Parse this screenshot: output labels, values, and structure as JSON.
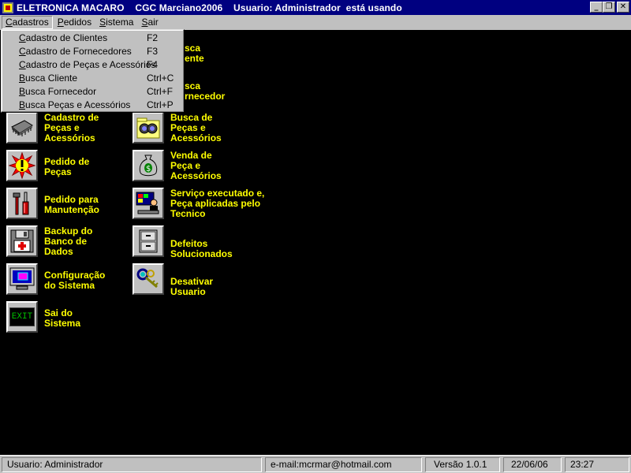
{
  "window": {
    "title": "ELETRONICA MACARO    CGC Marciano2006    Usuario: Administrador  está usando",
    "minimize_glyph": "_",
    "maximize_glyph": "❐",
    "close_glyph": "✕"
  },
  "menubar": {
    "items": [
      {
        "label": "Cadastros"
      },
      {
        "label": "Pedidos"
      },
      {
        "label": "Sistema"
      },
      {
        "label": "Sair"
      }
    ]
  },
  "dropdown": {
    "items": [
      {
        "label": "Cadastro de Clientes",
        "shortcut": "F2"
      },
      {
        "label": "Cadastro de Fornecedores",
        "shortcut": "F3"
      },
      {
        "label": "Cadastro de Peças e Acessórios",
        "shortcut": "F4"
      },
      {
        "label": "Busca Cliente",
        "shortcut": "Ctrl+C"
      },
      {
        "label": "Busca Fornecedor",
        "shortcut": "Ctrl+F"
      },
      {
        "label": "Busca Peças e Acessórios",
        "shortcut": "Ctrl+P"
      }
    ]
  },
  "left_tiles": [
    {
      "label": "Cadastro de\nPeças e\nAcessórios",
      "icon": "chip-icon"
    },
    {
      "label": "Pedido de\nPeças",
      "icon": "alert-icon"
    },
    {
      "label": "Pedido para\nManutenção",
      "icon": "tools-icon"
    },
    {
      "label": "Backup do\nBanco de\nDados",
      "icon": "floppy-icon"
    },
    {
      "label": "Configuração\ndo Sistema",
      "icon": "monitor-icon"
    },
    {
      "label": "Sai do\nSistema",
      "icon": "exit-icon",
      "icon_text": "EXIT"
    }
  ],
  "right_tiles": [
    {
      "label": "Busca de\nPeças e\nAcessórios",
      "icon": "binoculars-folder-icon"
    },
    {
      "label": "Venda de\nPeça e\nAcessórios",
      "icon": "money-bag-icon"
    },
    {
      "label": "Serviço executado e,\nPeça aplicadas pelo\nTecnico",
      "icon": "technician-icon"
    },
    {
      "label": "Defeitos\nSolucionados",
      "icon": "cabinet-icon"
    },
    {
      "label": "Desativar\nUsuario",
      "icon": "keys-icon"
    }
  ],
  "partial_labels": {
    "busca_cliente": "sca\nente",
    "busca_fornecedor": "sca\nrnecedor"
  },
  "statusbar": {
    "user": "Usuario: Administrador",
    "email": "e-mail:mcrmar@hotmail.com",
    "version": "Versão 1.0.1",
    "date": "22/06/06",
    "time": "23:27"
  },
  "colors": {
    "desktop": "#000000",
    "label": "#ffff00",
    "titlebar": "#000080",
    "chrome": "#c0c0c0"
  }
}
